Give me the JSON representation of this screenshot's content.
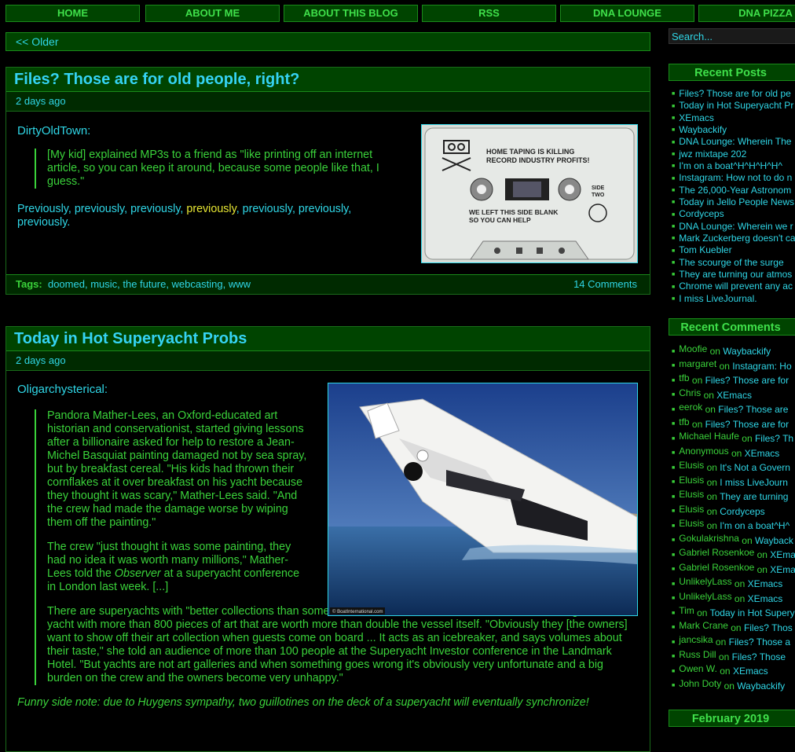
{
  "nav": [
    "HOME",
    "ABOUT ME",
    "ABOUT THIS BLOG",
    "RSS",
    "DNA LOUNGE",
    "DNA PIZZA"
  ],
  "older": "<< Older",
  "search_placeholder": "Search...",
  "posts": [
    {
      "title": "Files? Those are for old people, right?",
      "date": "2 days ago",
      "author": "DirtyOldTown:",
      "quote": "[My kid] explained MP3s to a friend as \"like printing off an internet article, so you can keep it around, because some people like that, I guess.\"",
      "links": [
        "Previously",
        "previously",
        "previously",
        "previously",
        "previously",
        "previously",
        "previously"
      ],
      "tags_label": "Tags:",
      "tags": [
        "doomed",
        "music",
        "the future",
        "webcasting",
        "www"
      ],
      "comments": "14 Comments",
      "cassette": {
        "line1": "HOME TAPING IS KILLING",
        "line2": "RECORD INDUSTRY PROFITS!",
        "side": "SIDE",
        "two": "TWO",
        "blank1": "WE LEFT THIS SIDE BLANK",
        "blank2": "SO YOU CAN HELP"
      }
    },
    {
      "title": "Today in Hot Superyacht Probs",
      "date": "2 days ago",
      "author": "Oligarchysterical:",
      "quote_p1": "Pandora Mather-Lees, an Oxford-educated art historian and conservationist, started giving lessons after a billionaire asked for help to restore a Jean-Michel Basquiat painting damaged not by sea spray, but by breakfast cereal. \"His kids had thrown their cornflakes at it over breakfast on his yacht because they thought it was scary,\" Mather-Lees said. \"And the crew had made the damage worse by wiping them off the painting.\"",
      "quote_p2a": "The crew \"just thought it was some painting, they had no idea it was worth many millions,\" Mather-Lees told the ",
      "quote_p2em": "Observer",
      "quote_p2b": " at a superyacht conference in London last week. [...]",
      "quote_p3": "There are superyachts with \"better collections than some national museums,\" Mather-Lees said, describing one yacht with more than 800 pieces of art that are worth more than double the vessel itself. \"Obviously they [the owners] want to show off their art collection when guests come on board ... It acts as an icebreaker, and says volumes about their taste,\" she told an audience of more than 100 people at the Superyacht Investor conference in the Landmark Hotel. \"But yachts are not art galleries and when something goes wrong it's obviously very unfortunate and a big burden on the crew and the owners become very unhappy.\"",
      "footnote": "Funny side note: due to Huygens sympathy, two guillotines on the deck of a superyacht will eventually synchronize!",
      "image_credit": "© BoatInternational.com"
    }
  ],
  "sidebar": {
    "recent_posts_title": "Recent Posts",
    "recent_posts": [
      "Files? Those are for old pe",
      "Today in Hot Superyacht Pr",
      "XEmacs",
      "Waybackify",
      "DNA Lounge: Wherein The",
      "jwz mixtape 202",
      "I'm on a boat^H^H^H^H^",
      "Instagram: How not to do n",
      "The 26,000-Year Astronom",
      "Today in Jello People News",
      "Cordyceps",
      "DNA Lounge: Wherein we r",
      "Mark Zuckerberg doesn't ca",
      "Tom Kuebler",
      "The scourge of the surge",
      "They are turning our atmos",
      "Chrome will prevent any ac",
      "I miss LiveJournal."
    ],
    "recent_comments_title": "Recent Comments",
    "recent_comments": [
      {
        "who": "Moofie",
        "on": "Waybackify"
      },
      {
        "who": "margaret",
        "on": "Instagram: Ho"
      },
      {
        "who": "tfb",
        "on": "Files? Those are for"
      },
      {
        "who": "Chris",
        "on": "XEmacs"
      },
      {
        "who": "eerok",
        "on": "Files? Those are"
      },
      {
        "who": "tfb",
        "on": "Files? Those are for"
      },
      {
        "who": "Michael Haufe",
        "on": "Files? Th"
      },
      {
        "who": "Anonymous",
        "on": "XEmacs"
      },
      {
        "who": "Elusis",
        "on": "It's Not a Govern"
      },
      {
        "who": "Elusis",
        "on": "I miss LiveJourn"
      },
      {
        "who": "Elusis",
        "on": "They are turning"
      },
      {
        "who": "Elusis",
        "on": "Cordyceps"
      },
      {
        "who": "Elusis",
        "on": "I'm on a boat^H^"
      },
      {
        "who": "Gokulakrishna",
        "on": "Wayback"
      },
      {
        "who": "Gabriel Rosenkoe",
        "on": "XEma"
      },
      {
        "who": "Gabriel Rosenkoe",
        "on": "XEma"
      },
      {
        "who": "UnlikelyLass",
        "on": "XEmacs"
      },
      {
        "who": "UnlikelyLass",
        "on": "XEmacs"
      },
      {
        "who": "Tim",
        "on": "Today in Hot Supery"
      },
      {
        "who": "Mark Crane",
        "on": "Files? Thos"
      },
      {
        "who": "jancsika",
        "on": "Files? Those a"
      },
      {
        "who": "Russ Dill",
        "on": "Files? Those"
      },
      {
        "who": "Owen W.",
        "on": "XEmacs"
      },
      {
        "who": "John Doty",
        "on": "Waybackify"
      }
    ],
    "archive_title": "February 2019"
  }
}
